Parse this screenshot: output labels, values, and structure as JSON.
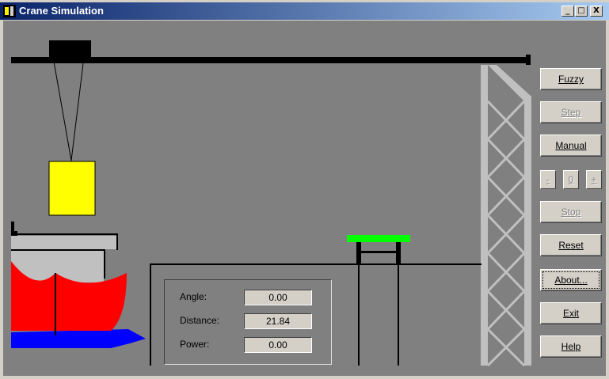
{
  "window": {
    "title": "Crane Simulation",
    "controls": {
      "minimize": "_",
      "maximize": "□",
      "close": "X"
    }
  },
  "buttons": {
    "fuzzy": "Fuzzy",
    "step": "Step",
    "manual": "Manual",
    "minus": "-",
    "zero": "0",
    "plus": "+",
    "stop": "Stop",
    "reset": "Reset",
    "about": "About...",
    "exit": "Exit",
    "help": "Help"
  },
  "readout": {
    "angle_label": "Angle:",
    "angle_value": "0.00",
    "distance_label": "Distance:",
    "distance_value": "21.84",
    "power_label": "Power:",
    "power_value": "0.00"
  },
  "colors": {
    "background": "#808080",
    "container": "#ffff00",
    "target_platform": "#00ff00",
    "ship_hull": "#ff0000",
    "water": "#0000ff",
    "tower": "#c0c0c0"
  }
}
